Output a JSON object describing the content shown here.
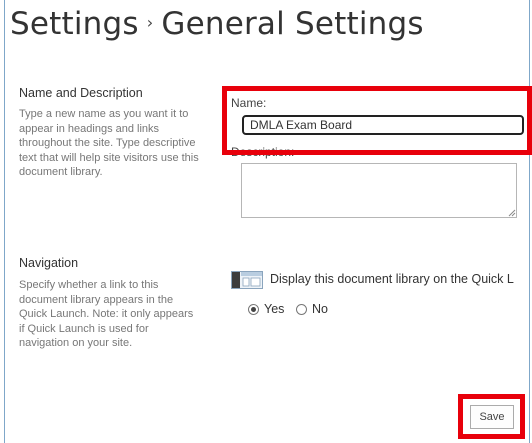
{
  "header": {
    "breadcrumb_root": "Settings",
    "separator": "›",
    "page_title": "General Settings"
  },
  "name_section": {
    "heading": "Name and Description",
    "description": "Type a new name as you want it to appear in headings and links throughout the site. Type descriptive text that will help site visitors use this document library.",
    "name_label": "Name:",
    "name_value": "DMLA Exam Board",
    "description_label": "Description:",
    "description_value": ""
  },
  "navigation_section": {
    "heading": "Navigation",
    "description": "Specify whether a link to this document library appears in the Quick Launch. Note: it only appears if Quick Launch is used for navigation on your site.",
    "quick_launch_label": "Display this document library on the Quick L",
    "options": [
      {
        "label": "Yes",
        "selected": true
      },
      {
        "label": "No",
        "selected": false
      }
    ]
  },
  "actions": {
    "save_label": "Save"
  },
  "colors": {
    "highlight": "#e8000b",
    "border_accent": "#7fa7c9"
  }
}
